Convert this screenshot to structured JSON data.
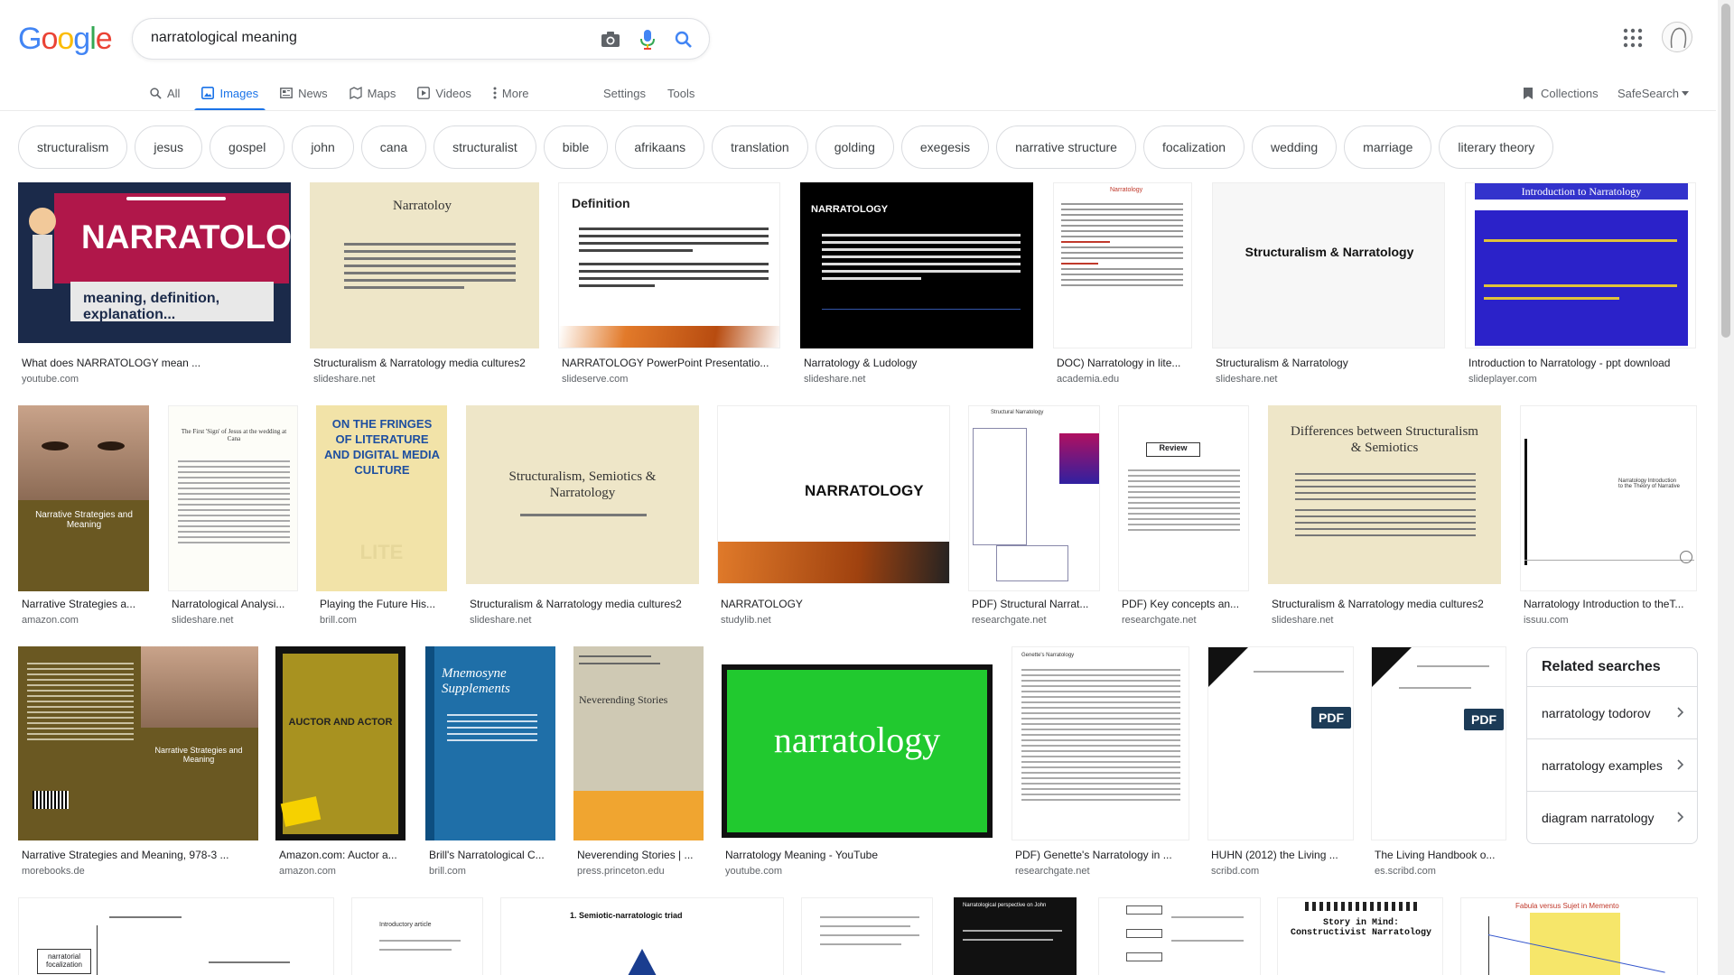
{
  "logo": {
    "letters": [
      "G",
      "o",
      "o",
      "g",
      "l",
      "e"
    ],
    "colors": [
      "#4285F4",
      "#EA4335",
      "#FBBC05",
      "#4285F4",
      "#34A853",
      "#EA4335"
    ]
  },
  "search": {
    "query": "narratological meaning"
  },
  "tabs": [
    {
      "label": "All",
      "icon": "search-icon"
    },
    {
      "label": "Images",
      "icon": "image-icon"
    },
    {
      "label": "News",
      "icon": "news-icon"
    },
    {
      "label": "Maps",
      "icon": "map-icon"
    },
    {
      "label": "Videos",
      "icon": "video-icon"
    },
    {
      "label": "More",
      "icon": "more-icon"
    }
  ],
  "tools": {
    "settings": "Settings",
    "tools": "Tools",
    "collections": "Collections",
    "safesearch": "SafeSearch"
  },
  "chips": [
    "structuralism",
    "jesus",
    "gospel",
    "john",
    "cana",
    "structuralist",
    "bible",
    "afrikaans",
    "translation",
    "golding",
    "exegesis",
    "narrative structure",
    "focalization",
    "wedding",
    "marriage",
    "literary theory"
  ],
  "results": [
    {
      "title": "What does NARRATOLOGY mean ...",
      "source": "youtube.com",
      "thumb_text": "NARRATOLOGY",
      "thumb_sub": "meaning, definition, explanation..."
    },
    {
      "title": "Structuralism & Narratology media cultures2",
      "source": "slideshare.net",
      "thumb_text": "Narratoloy"
    },
    {
      "title": "NARRATOLOGY PowerPoint Presentatio...",
      "source": "slideserve.com",
      "thumb_text": "Definition"
    },
    {
      "title": "Narratology & Ludology",
      "source": "slideshare.net",
      "thumb_text": "NARRATOLOGY"
    },
    {
      "title": "DOC) Narratology in lite...",
      "source": "academia.edu",
      "thumb_text": "Narratology"
    },
    {
      "title": "Structuralism & Narratology",
      "source": "slideshare.net",
      "thumb_text": "Structuralism & Narratology"
    },
    {
      "title": "Introduction to Narratology - ppt download",
      "source": "slideplayer.com",
      "thumb_text": "Introduction to Narratology"
    },
    {
      "title": "Narrative Strategies a...",
      "source": "amazon.com",
      "thumb_text": "Narrative Strategies and Meaning"
    },
    {
      "title": "Narratological Analysi...",
      "source": "slideshare.net",
      "thumb_text": "The First 'Sign' of Jesus at the wedding at Cana"
    },
    {
      "title": "Playing the Future His...",
      "source": "brill.com",
      "thumb_text": "ON THE FRINGES OF LITERATURE AND DIGITAL MEDIA CULTURE"
    },
    {
      "title": "Structuralism & Narratology media cultures2",
      "source": "slideshare.net",
      "thumb_text": "Structuralism, Semiotics & Narratology"
    },
    {
      "title": "NARRATOLOGY",
      "source": "studylib.net",
      "thumb_text": "NARRATOLOGY"
    },
    {
      "title": "PDF) Structural Narrat...",
      "source": "researchgate.net",
      "thumb_text": "Structural Narratology"
    },
    {
      "title": "PDF) Key concepts an...",
      "source": "researchgate.net",
      "thumb_text": "Review"
    },
    {
      "title": "Structuralism & Narratology media cultures2",
      "source": "slideshare.net",
      "thumb_text": "Differences between Structuralism & Semiotics"
    },
    {
      "title": "Narratology Introduction to theT...",
      "source": "issuu.com",
      "thumb_text": "Narratology Introduction to the Theory of Narrative"
    },
    {
      "title": "Narrative Strategies and Meaning, 978-3 ...",
      "source": "morebooks.de",
      "thumb_text": "Narrative Strategies and Meaning"
    },
    {
      "title": "Amazon.com: Auctor a...",
      "source": "amazon.com",
      "thumb_text": "AUCTOR AND ACTOR"
    },
    {
      "title": "Brill's Narratological C...",
      "source": "brill.com",
      "thumb_text": "Mnemosyne Supplements"
    },
    {
      "title": "Neverending Stories | ...",
      "source": "press.princeton.edu",
      "thumb_text": "Neverending Stories"
    },
    {
      "title": "Narratology Meaning - YouTube",
      "source": "youtube.com",
      "thumb_text": "narratology"
    },
    {
      "title": "PDF) Genette's Narratology in ...",
      "source": "researchgate.net",
      "thumb_text": "Genette's Narratology"
    },
    {
      "title": "HUHN (2012) the Living ...",
      "source": "scribd.com",
      "thumb_text": "PDF"
    },
    {
      "title": "The Living Handbook o...",
      "source": "es.scribd.com",
      "thumb_text": "PDF"
    }
  ],
  "bottom_thumbs": [
    "narratorial focalization",
    "Introductory article",
    "1. Semiotic-narratologic triad",
    "",
    "Narratological perspective on John",
    "",
    "Story in Mind: Constructivist Narratology",
    "Fabula versus Sujet in Memento"
  ],
  "related": {
    "title": "Related searches",
    "items": [
      "narratology todorov",
      "narratology examples",
      "diagram narratology"
    ]
  }
}
